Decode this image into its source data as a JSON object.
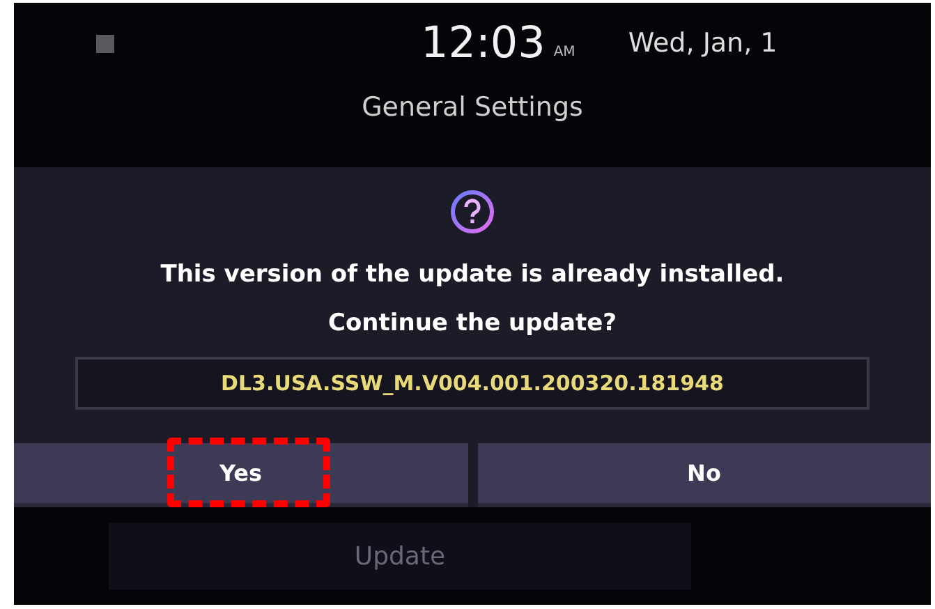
{
  "status_bar": {
    "time": "12:03",
    "meridiem": "AM",
    "date": "Wed, Jan, 1"
  },
  "title": "General Settings",
  "dialog": {
    "message": [
      "This version of the update is already installed.",
      "Continue the update?"
    ],
    "version": "DL3.USA.SSW_M.V004.001.200320.181948",
    "buttons": [
      {
        "label": "Yes",
        "highlighted": true
      },
      {
        "label": "No",
        "highlighted": false
      }
    ]
  },
  "background_button": {
    "label": "Update",
    "disabled": true
  }
}
